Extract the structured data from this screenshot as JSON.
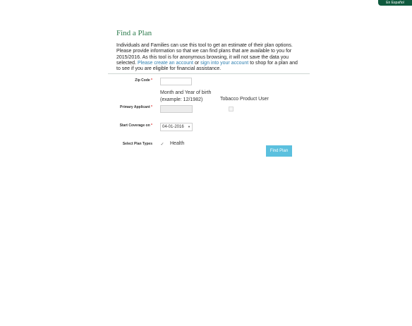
{
  "header": {
    "language_link": "En Español"
  },
  "page": {
    "title": "Find a Plan",
    "intro_text": "Individuals and Families can use this tool to get an estimate of their plan options. Please provide information so that we can find plans that are available to you for 2015/2016. As this tool is for anonymous browsing, it will not save the data you selected.",
    "create_account_link": "Please create an account",
    "connector_or": "or",
    "sign_in_link": "sign into your account",
    "intro_text_end": "to shop for a plan and to see if you are eligible for financial assistance."
  },
  "form": {
    "zip_label": "Zip Code",
    "required_mark": "*",
    "zip_value": "",
    "birth_hint": "Month and Year of birth (example: 12/1982)",
    "tobacco_label": "Tobacco Product User",
    "primary_applicant_label": "Primary Applicant",
    "birth_value": "",
    "tobacco_checked": false,
    "coverage_label": "Start Coverage on",
    "coverage_value": "04-01-2016",
    "plan_types_label": "Select Plan Types",
    "health_label": "Health",
    "health_checked": true,
    "submit_label": "Find Plan"
  },
  "colors": {
    "title": "#2b7a4b",
    "link": "#2f7fb0",
    "button": "#5bc0de",
    "lang_tab": "#0f5a3e",
    "required": "#dd3333"
  }
}
